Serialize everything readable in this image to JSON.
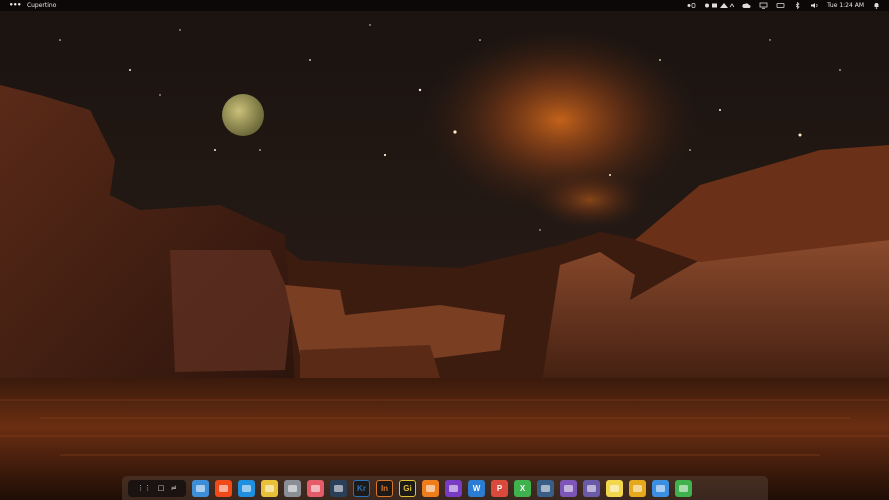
{
  "topbar": {
    "menu_glyph": "•••",
    "workspace_label": "Cupertino",
    "clock": "Tue 1:24 AM"
  },
  "dock": {
    "apps": [
      {
        "name": "file-manager-icon",
        "color": "#3d8ed8"
      },
      {
        "name": "brave-icon",
        "color": "#f04a1a"
      },
      {
        "name": "vscode-icon",
        "color": "#1f8fe0"
      },
      {
        "name": "notes-icon",
        "color": "#e8c03a"
      },
      {
        "name": "archive-icon",
        "color": "#8a8f96"
      },
      {
        "name": "screenshot-icon",
        "color": "#e45b6a"
      },
      {
        "name": "steam-icon",
        "color": "#2a3f5a"
      },
      {
        "name": "krita-icon",
        "label": "Kr",
        "color": "#2b6fb5"
      },
      {
        "name": "indesign-icon",
        "label": "In",
        "color": "#d9762a"
      },
      {
        "name": "gif-icon",
        "label": "Gi",
        "color": "#e0c031"
      },
      {
        "name": "orange-app-icon",
        "color": "#f07d1b"
      },
      {
        "name": "video-player-icon",
        "color": "#7a3bc4"
      },
      {
        "name": "word-icon",
        "label": "W",
        "color": "#2b7cd3"
      },
      {
        "name": "presentation-icon",
        "label": "P",
        "color": "#d94a3d"
      },
      {
        "name": "spreadsheet-icon",
        "label": "X",
        "color": "#3fb24e"
      },
      {
        "name": "terminal-icon",
        "color": "#3a5f86"
      },
      {
        "name": "camera-icon",
        "color": "#7d55b8"
      },
      {
        "name": "game-icon",
        "color": "#6a5aa8"
      },
      {
        "name": "sticky-notes-icon",
        "color": "#f2d64b"
      },
      {
        "name": "launcher-icon",
        "color": "#e6a91c"
      },
      {
        "name": "downloads-icon",
        "color": "#3c8fe0"
      },
      {
        "name": "trash-icon",
        "color": "#3fb24e"
      }
    ]
  }
}
